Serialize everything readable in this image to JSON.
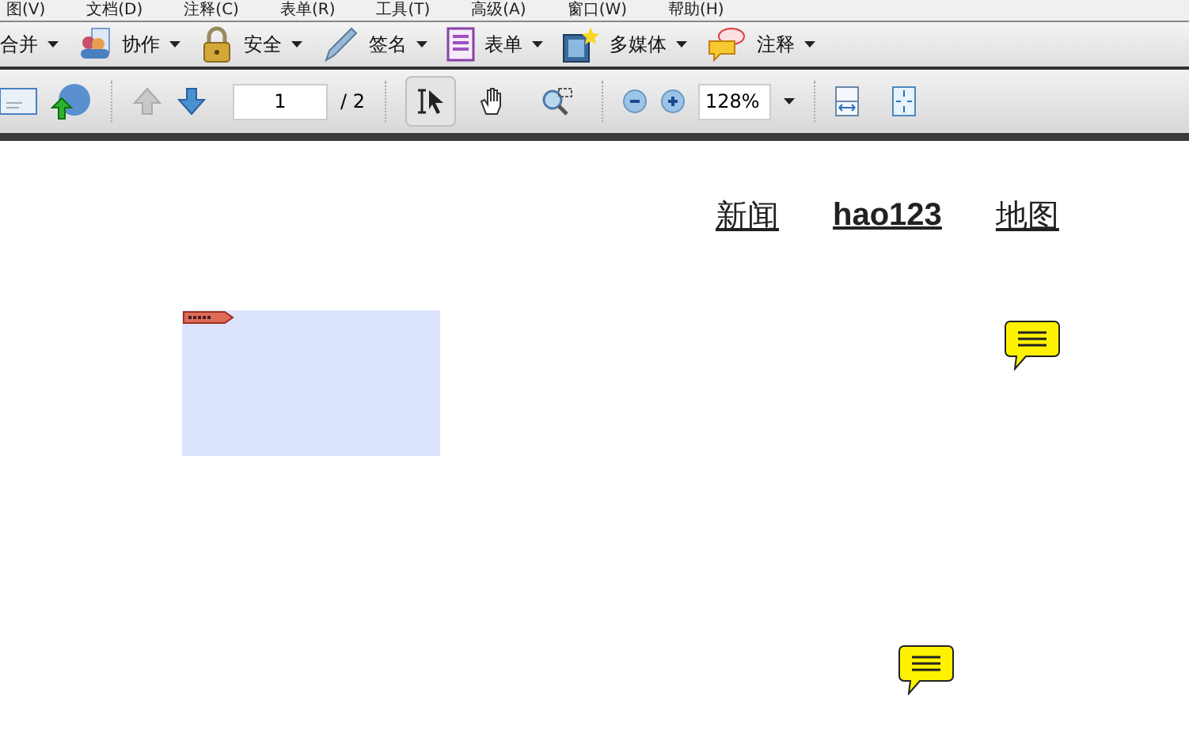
{
  "menu": [
    "图(V)",
    "文档(D)",
    "注释(C)",
    "表单(R)",
    "工具(T)",
    "高级(A)",
    "窗口(W)",
    "帮助(H)"
  ],
  "toolbar": [
    {
      "kind": "merge",
      "label": "合并"
    },
    {
      "kind": "people",
      "label": "协作"
    },
    {
      "kind": "lock",
      "label": "安全"
    },
    {
      "kind": "pen",
      "label": "签名"
    },
    {
      "kind": "form",
      "label": "表单"
    },
    {
      "kind": "film",
      "label": "多媒体"
    },
    {
      "kind": "comment",
      "label": "注释"
    }
  ],
  "nav": {
    "prev_disabled": true,
    "next_disabled": false,
    "page": "1",
    "total": "/ 2"
  },
  "tools": [
    {
      "kind": "select",
      "selected": true
    },
    {
      "kind": "hand",
      "selected": false
    },
    {
      "kind": "marquee",
      "selected": false
    }
  ],
  "zoom": {
    "value": "128%"
  },
  "page": {
    "links": [
      {
        "label": "新闻",
        "bold": false
      },
      {
        "label": "hao123",
        "bold": true
      },
      {
        "label": "地图",
        "bold": false
      }
    ],
    "notes": [
      {
        "kind": "note"
      },
      {
        "kind": "note"
      }
    ]
  }
}
